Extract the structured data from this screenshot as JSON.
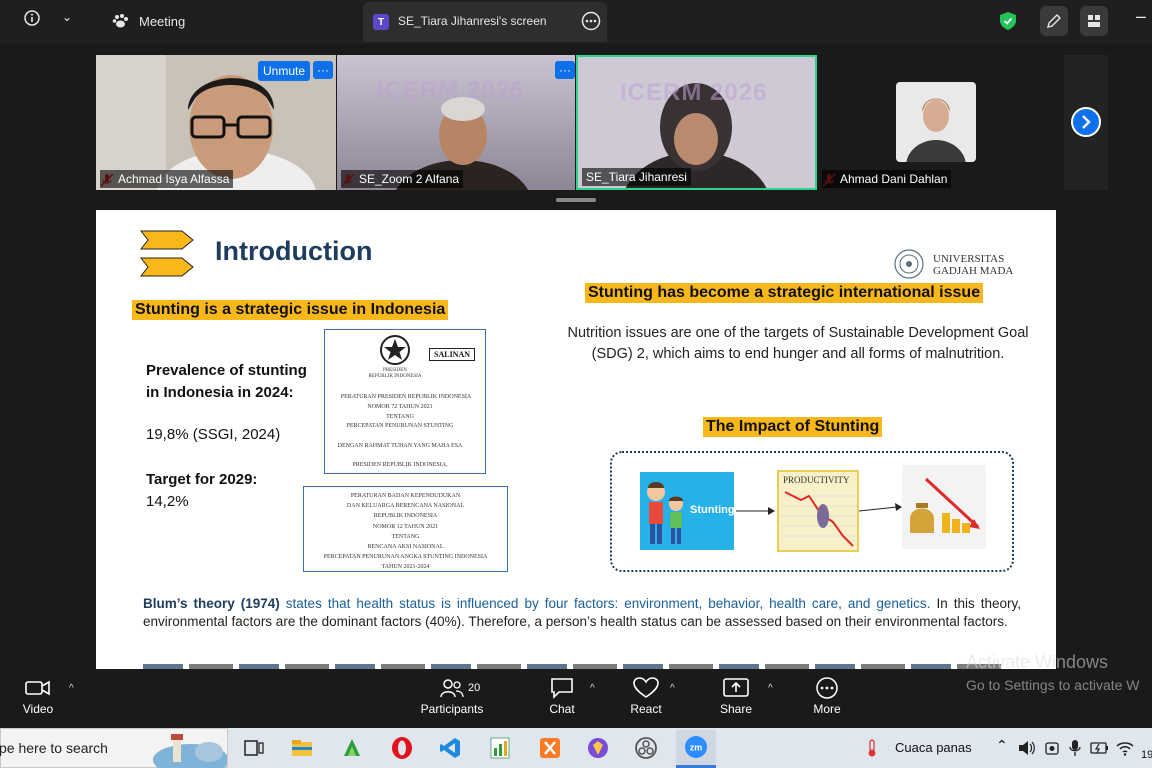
{
  "topbar": {
    "meeting_label": "Meeting",
    "share_badge": "T",
    "share_title": "SE_Tiara Jihanresi's screen"
  },
  "participants_strip": {
    "unmute_label": "Unmute",
    "more_label": "···",
    "tiles": [
      {
        "name": "Achmad Isya Alfassa"
      },
      {
        "name": "SE_Zoom 2 Alfana"
      },
      {
        "name": "SE_Tiara Jihanresi"
      },
      {
        "name": "Ahmad Dani Dahlan"
      }
    ],
    "backdrop_text": "ICERM 2026"
  },
  "slide": {
    "title": "Introduction",
    "ugm_line1": "UNIVERSITAS",
    "ugm_line2": "GADJAH MADA",
    "left_heading": "Stunting is a strategic issue in Indonesia",
    "prevalence_label": "Prevalence of stunting in Indonesia in 2024:",
    "prevalence_value": "19,8% (SSGI, 2024)",
    "target_label": "Target for 2029:",
    "target_value": "14,2%",
    "doc1": {
      "salinan": "SALINAN",
      "line1": "PRESIDEN",
      "line2": "REPUBLIK INDONESIA",
      "line3": "PERATURAN PRESIDEN REPUBLIK INDONESIA",
      "line4": "NOMOR  72  TAHUN 2021",
      "line5": "TENTANG",
      "line6": "PERCEPATAN PENURUNAN STUNTING",
      "line7": "DENGAN RAHMAT TUHAN YANG MAHA ESA",
      "line8": "PRESIDEN REPUBLIK INDONESIA,"
    },
    "doc2": {
      "line1": "PERATURAN BADAN KEPENDUDUKAN",
      "line2": "DAN KELUARGA BERENCANA NASIONAL",
      "line3": "REPUBLIK INDONESIA",
      "line4": "NOMOR 12 TAHUN 2021",
      "line5": "TENTANG",
      "line6": "RENCANA AKSI NASIONAL",
      "line7": "PERCEPATAN PENURUNAN ANGKA STUNTING INDONESIA",
      "line8": "TAHUN 2021-2024"
    },
    "right_heading": "Stunting has become a strategic international issue",
    "sdg_text": "Nutrition issues are one of the targets of Sustainable Development Goal (SDG) 2, which aims to end hunger and all forms of malnutrition.",
    "impact_heading": "The Impact of Stunting",
    "impact_stunting_label": "Stunting",
    "impact_productivity_label": "PRODUCTIVITY",
    "blum_bold": "Blum’s theory (1974)",
    "blum_blue": " states that health status is influenced by four factors: environment, behavior, health care, and genetics.",
    "blum_rest": " In this theory, environmental factors are the dominant factors (40%). Therefore, a person’s health status can be assessed based on their environmental factors."
  },
  "toolbar": {
    "video": "Video",
    "participants": "Participants",
    "participants_count": "20",
    "chat": "Chat",
    "react": "React",
    "share": "Share",
    "more": "More"
  },
  "watermark": {
    "line1": "Activate Windows",
    "line2": "Go to Settings to activate W"
  },
  "taskbar": {
    "search_text": "pe here to search",
    "weather": "Cuaca panas",
    "clock_partial": "19"
  },
  "colors": {
    "accent_blue": "#0e71eb",
    "active_green": "#2bd48a",
    "highlight_yellow": "#f9b81a",
    "title_navy": "#1d3c5e"
  }
}
